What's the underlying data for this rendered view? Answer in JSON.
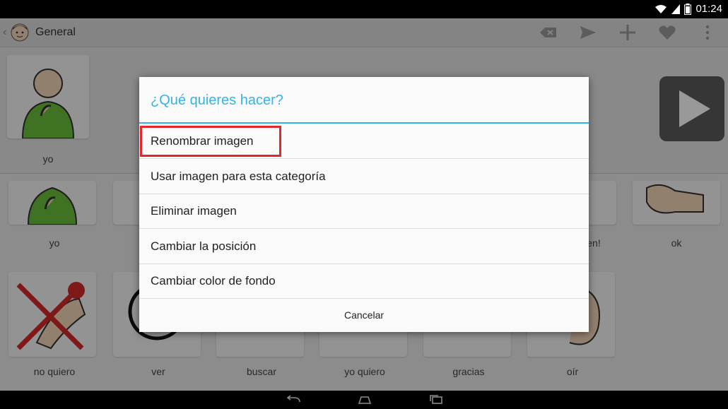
{
  "status": {
    "time": "01:24"
  },
  "actionbar": {
    "title": "General"
  },
  "sentence": {
    "items": [
      {
        "label": "yo"
      }
    ]
  },
  "grid": {
    "row1": [
      {
        "label": "yo"
      },
      {
        "label": "en!"
      },
      {
        "label": "ok"
      }
    ],
    "row2": [
      {
        "label": "no quiero"
      },
      {
        "label": "ver"
      },
      {
        "label": "buscar"
      },
      {
        "label": "yo quiero"
      },
      {
        "label": "gracias"
      },
      {
        "label": "oír"
      }
    ]
  },
  "dialog": {
    "title": "¿Qué quieres hacer?",
    "options": [
      "Renombrar imagen",
      "Usar imagen para esta categoría",
      "Eliminar imagen",
      "Cambiar la posición",
      "Cambiar color de fondo"
    ],
    "cancel": "Cancelar"
  },
  "colors": {
    "accent": "#33b5e5",
    "highlight": "#e3282c",
    "actionbar": "#dcdcdc"
  },
  "icons": [
    "wifi-icon",
    "signal-icon",
    "battery-icon",
    "back-icon",
    "backspace-icon",
    "send-icon",
    "add-icon",
    "favorite-icon",
    "overflow-menu-icon",
    "play-icon",
    "nav-back-icon",
    "nav-home-icon",
    "nav-recents-icon"
  ]
}
